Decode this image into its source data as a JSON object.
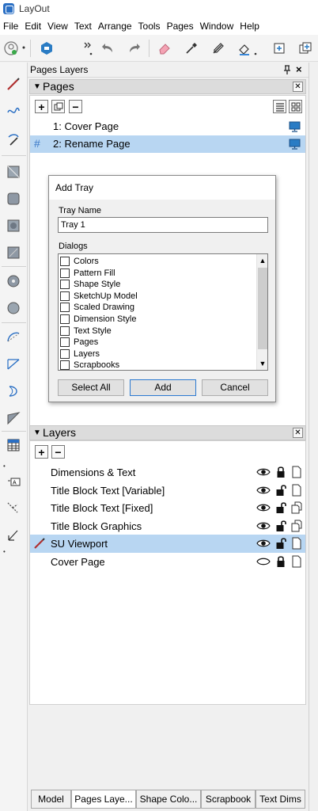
{
  "app": {
    "title": "LayOut"
  },
  "menu": [
    "File",
    "Edit",
    "View",
    "Text",
    "Arrange",
    "Tools",
    "Pages",
    "Window",
    "Help"
  ],
  "trays": {
    "title": "Pages Layers",
    "pin_glyph": "ᵾ",
    "close_glyph": "×"
  },
  "pages": {
    "header": "Pages",
    "add_glyph": "+",
    "remove_glyph": "−",
    "items": [
      {
        "number": "1:",
        "name": "Cover Page",
        "selected": false
      },
      {
        "number": "2:",
        "name": "Rename Page",
        "selected": true
      }
    ]
  },
  "dialog": {
    "title": "Add Tray",
    "tray_name_label": "Tray Name",
    "tray_name_value": "Tray 1",
    "dialogs_label": "Dialogs",
    "items": [
      "Colors",
      "Pattern Fill",
      "Shape Style",
      "SketchUp Model",
      "Scaled Drawing",
      "Dimension Style",
      "Text Style",
      "Pages",
      "Layers",
      "Scrapbooks"
    ],
    "buttons": {
      "select_all": "Select All",
      "add": "Add",
      "cancel": "Cancel"
    }
  },
  "layers": {
    "header": "Layers",
    "add_glyph": "+",
    "remove_glyph": "−",
    "items": [
      {
        "name": "Dimensions & Text",
        "visible": true,
        "locked": true,
        "shared": false,
        "selected": false
      },
      {
        "name": "Title Block Text [Variable]",
        "visible": true,
        "locked": false,
        "shared": false,
        "selected": false
      },
      {
        "name": "Title Block Text [Fixed]",
        "visible": true,
        "locked": false,
        "shared": true,
        "selected": false
      },
      {
        "name": "Title Block Graphics",
        "visible": true,
        "locked": false,
        "shared": true,
        "selected": false
      },
      {
        "name": "SU Viewport",
        "visible": true,
        "locked": false,
        "shared": false,
        "selected": true
      },
      {
        "name": "Cover Page",
        "visible": false,
        "locked": true,
        "shared": false,
        "selected": false
      }
    ]
  },
  "bottom_tabs": [
    "Model",
    "Pages Laye...",
    "Shape Colo...",
    "Scrapbook",
    "Text Dims"
  ],
  "colors": {
    "selection": "#b8d6f2",
    "accent": "#2b79d0",
    "pencil": "#b03030"
  }
}
